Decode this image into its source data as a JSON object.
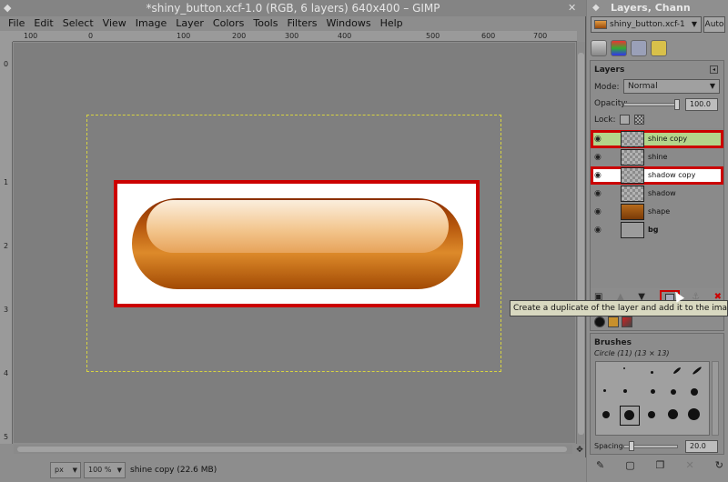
{
  "window": {
    "title": "*shiny_button.xcf-1.0 (RGB, 6 layers) 640x400 – GIMP",
    "menu": [
      "File",
      "Edit",
      "Select",
      "View",
      "Image",
      "Layer",
      "Colors",
      "Tools",
      "Filters",
      "Windows",
      "Help"
    ],
    "ruler_h_ticks": [
      "100",
      "0",
      "100",
      "200",
      "300",
      "400",
      "500",
      "600",
      "700"
    ],
    "ruler_v_ticks": [
      "0",
      "1",
      "2",
      "3",
      "4",
      "5"
    ]
  },
  "status": {
    "unit": "px",
    "zoom": "100 %",
    "message": "shine copy (22.6 MB)"
  },
  "dock": {
    "title": "Layers, Chann",
    "image_name": "shiny_button.xcf-1",
    "auto_label": "Auto",
    "layers_panel": {
      "title": "Layers",
      "mode_label": "Mode:",
      "mode_value": "Normal",
      "opacity_label": "Opacity:",
      "opacity_value": "100.0",
      "lock_label": "Lock:",
      "layers": [
        {
          "name": "shine copy",
          "selected": true,
          "highlighted": true
        },
        {
          "name": "shine",
          "selected": false,
          "highlighted": false
        },
        {
          "name": "shadow copy",
          "selected": false,
          "highlighted": true
        },
        {
          "name": "shadow",
          "selected": false,
          "highlighted": false
        },
        {
          "name": "shape",
          "selected": false,
          "highlighted": false
        },
        {
          "name": "bg",
          "selected": false,
          "highlighted": false
        }
      ]
    },
    "tooltip": "Create a duplicate of the layer and add it to the image",
    "brushes_panel": {
      "title": "Brushes",
      "selected_brush": "Circle (11) (13 × 13)",
      "spacing_label": "Spacing:",
      "spacing_value": "20.0"
    }
  },
  "colors": {
    "highlight_red": "#cc0000",
    "selection_green": "#b4d48a"
  }
}
